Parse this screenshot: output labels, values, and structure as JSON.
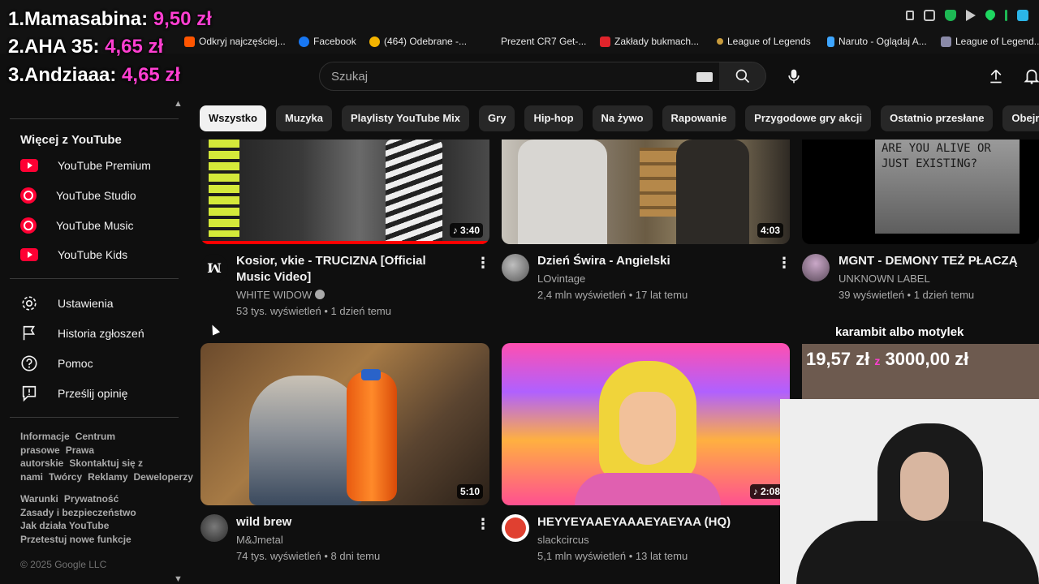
{
  "overlay": {
    "donors": [
      {
        "rank": "1.",
        "name": "Mamasabina:",
        "amount": "9,50 zł"
      },
      {
        "rank": "2.",
        "name": "AHA 35:",
        "amount": "4,65 zł"
      },
      {
        "rank": "3.",
        "name": "Andziaaa:",
        "amount": "4,65 zł"
      }
    ],
    "donation_label": "karambit albo motylek",
    "donation_current": "19,57 zł",
    "donation_separator": "z",
    "donation_goal": "3000,00 zł"
  },
  "bookmarks": [
    {
      "label": "Odkryj najczęściej...",
      "color": "#ff5500"
    },
    {
      "label": "Facebook",
      "color": "#1877f2"
    },
    {
      "label": "(464) Odebrane -...",
      "color": "#f4b400"
    },
    {
      "label": "Prezent CR7 Get-...",
      "color": "#121212"
    },
    {
      "label": "Zakłady bukmach...",
      "color": "#e0242b"
    },
    {
      "label": "League of Legends",
      "color": "#c89b3c"
    },
    {
      "label": "Naruto - Oglądaj A...",
      "color": "#3ea6ff"
    },
    {
      "label": "League of Legend...",
      "color": "#8a8aa8"
    }
  ],
  "header": {
    "search_placeholder": "Szukaj"
  },
  "chips": [
    "Wszystko",
    "Muzyka",
    "Playlisty YouTube Mix",
    "Gry",
    "Hip-hop",
    "Na żywo",
    "Rapowanie",
    "Przygodowe gry akcji",
    "Ostatnio przesłane",
    "Obejrzane"
  ],
  "sidebar": {
    "more_heading": "Więcej z YouTube",
    "more_items": [
      "YouTube Premium",
      "YouTube Studio",
      "YouTube Music",
      "YouTube Kids"
    ],
    "settings_items": [
      "Ustawienia",
      "Historia zgłoszeń",
      "Pomoc",
      "Prześlij opinię"
    ],
    "footer1": [
      "Informacje",
      "Centrum prasowe",
      "Prawa autorskie",
      "Skontaktuj się z nami",
      "Twórcy",
      "Reklamy",
      "Deweloperzy"
    ],
    "footer2": [
      "Warunki",
      "Prywatność",
      "Zasady i bezpieczeństwo",
      "Jak działa YouTube",
      "Przetestuj nowe funkcje"
    ],
    "copyright": "© 2025 Google LLC"
  },
  "videos": [
    {
      "title": "Kosior, vkie - TRUCIZNA [Official Music Video]",
      "channel": "WHITE WIDOW",
      "meta": "53 tys. wyświetleń • 1 dzień temu",
      "duration": "3:40",
      "progress": 1.0
    },
    {
      "title": "Dzień Świra - Angielski",
      "channel": "LOvintage",
      "meta": "2,4 mln wyświetleń • 17 lat temu",
      "duration": "4:03"
    },
    {
      "title": "MGNT - DEMONY TEŻ PŁACZĄ",
      "channel": "UNKNOWN LABEL",
      "meta": "39 wyświetleń • 1 dzień temu",
      "duration": "",
      "thumb_text": "ARE YOU ALIVE OR JUST EXISTING?"
    },
    {
      "title": "wild brew",
      "channel": "M&Jmetal",
      "meta": "74 tys. wyświetleń • 8 dni temu",
      "duration": "5:10"
    },
    {
      "title": "HEYYEYAAEYAAAEYAEYAA (HQ)",
      "channel": "slackcircus",
      "meta": "5,1 mln wyświetleń • 13 lat temu",
      "duration": "2:08"
    }
  ]
}
